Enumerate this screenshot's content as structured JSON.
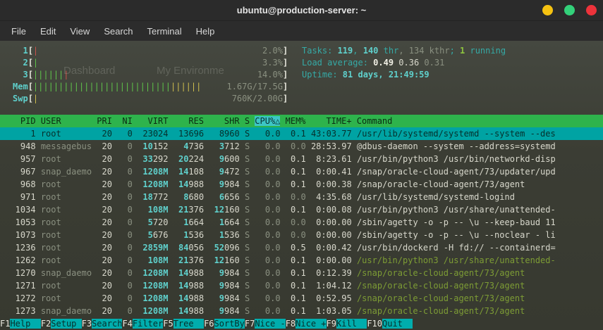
{
  "window": {
    "title": "ubuntu@production-server: ~"
  },
  "window_controls": [
    {
      "name": "minimize",
      "color": "#f5c211"
    },
    {
      "name": "maximize",
      "color": "#33d17a"
    },
    {
      "name": "close",
      "color": "#ed333b"
    }
  ],
  "menu": {
    "items": [
      "File",
      "Edit",
      "View",
      "Search",
      "Terminal",
      "Help"
    ]
  },
  "ghosts": [
    "Dashboard",
    "My Environme"
  ],
  "colors": {
    "cyan": "#35aaa6",
    "bcyan": "#5fd0cc",
    "white": "#d8d8cc",
    "bwhite": "#f0efe4",
    "gray": "#8a9080",
    "green": "#8ec43f",
    "cmdgreen": "#7d9c35",
    "headergreen": "#2eb34c",
    "selcyan": "#00a3a3",
    "fncyan": "#00adad"
  },
  "htop": {
    "meters": [
      {
        "label": "1",
        "ticks": [
          [
            "red",
            1
          ]
        ],
        "value": "2.0%"
      },
      {
        "label": "2",
        "ticks": [
          [
            "green",
            1
          ]
        ],
        "value": "3.3%"
      },
      {
        "label": "3",
        "ticks": [
          [
            "green",
            6
          ],
          [
            "red",
            1
          ]
        ],
        "value": "14.0%"
      },
      {
        "label": "Mem",
        "ticks": [
          [
            "green",
            27
          ],
          [
            "yellow",
            6
          ]
        ],
        "value": "1.67G/17.5G"
      },
      {
        "label": "Swp",
        "ticks": [
          [
            "yellow",
            1
          ]
        ],
        "value": "760K/2.00G"
      }
    ],
    "summary": [
      [
        [
          "Tasks: ",
          "cyan"
        ],
        [
          "119",
          "bcyan"
        ],
        [
          ", ",
          "cyan"
        ],
        [
          "140",
          "bcyan"
        ],
        [
          " thr",
          "cyan"
        ],
        [
          ", 134 kthr",
          "gray"
        ],
        [
          "; ",
          "cyan"
        ],
        [
          "1",
          "green"
        ],
        [
          " running",
          "cyan"
        ]
      ],
      [
        [
          "Load average: ",
          "cyan"
        ],
        [
          "0.49 ",
          "bwhite"
        ],
        [
          "0.36 ",
          "white"
        ],
        [
          "0.31",
          "gray"
        ]
      ],
      [
        [
          "Uptime: ",
          "cyan"
        ],
        [
          "81 days, 21:49:59",
          "bcyan"
        ]
      ]
    ],
    "columns": [
      "PID",
      "USER",
      "PRI",
      "NI",
      "VIRT",
      "RES",
      "SHR",
      "S",
      "CPU%△",
      "MEM%",
      "TIME+",
      "Command"
    ],
    "sort_column": "CPU%△",
    "rows": [
      {
        "pid": "1",
        "user": "root",
        "pri": "20",
        "ni": "0",
        "virt": "23024",
        "res": "13696",
        "shr": "8960",
        "s": "S",
        "cpu": "0.0",
        "mem": "0.1",
        "time": "43:03.77",
        "cmd": "/usr/lib/systemd/systemd --system --des",
        "selected": true
      },
      {
        "pid": "948",
        "user": "messagebus",
        "pri": "20",
        "ni": "0",
        "virt": "10152",
        "res": "4736",
        "shr": "3712",
        "s": "S",
        "cpu": "0.0",
        "mem": "0.0",
        "time": "28:53.97",
        "cmd": "@dbus-daemon --system --address=systemd"
      },
      {
        "pid": "957",
        "user": "root",
        "pri": "20",
        "ni": "0",
        "virt": "33292",
        "res": "20224",
        "shr": "9600",
        "s": "S",
        "cpu": "0.0",
        "mem": "0.1",
        "time": "8:23.61",
        "cmd": "/usr/bin/python3 /usr/bin/networkd-disp"
      },
      {
        "pid": "967",
        "user": "snap_daemo",
        "pri": "20",
        "ni": "0",
        "virt": "1208M",
        "res": "14108",
        "shr": "9472",
        "s": "S",
        "cpu": "0.0",
        "mem": "0.1",
        "time": "0:00.41",
        "cmd": "/snap/oracle-cloud-agent/73/updater/upd"
      },
      {
        "pid": "968",
        "user": "root",
        "pri": "20",
        "ni": "0",
        "virt": "1208M",
        "res": "14988",
        "shr": "9984",
        "s": "S",
        "cpu": "0.0",
        "mem": "0.1",
        "time": "0:00.38",
        "cmd": "/snap/oracle-cloud-agent/73/agent"
      },
      {
        "pid": "971",
        "user": "root",
        "pri": "20",
        "ni": "0",
        "virt": "18772",
        "res": "8680",
        "shr": "6656",
        "s": "S",
        "cpu": "0.0",
        "mem": "0.0",
        "time": "4:35.68",
        "cmd": "/usr/lib/systemd/systemd-logind"
      },
      {
        "pid": "1034",
        "user": "root",
        "pri": "20",
        "ni": "0",
        "virt": "108M",
        "res": "21376",
        "shr": "12160",
        "s": "S",
        "cpu": "0.0",
        "mem": "0.1",
        "time": "0:00.08",
        "cmd": "/usr/bin/python3 /usr/share/unattended-"
      },
      {
        "pid": "1053",
        "user": "root",
        "pri": "20",
        "ni": "0",
        "virt": "5720",
        "res": "1664",
        "shr": "1664",
        "s": "S",
        "cpu": "0.0",
        "mem": "0.0",
        "time": "0:00.00",
        "cmd": "/sbin/agetty -o -p -- \\u --keep-baud 11"
      },
      {
        "pid": "1073",
        "user": "root",
        "pri": "20",
        "ni": "0",
        "virt": "5676",
        "res": "1536",
        "shr": "1536",
        "s": "S",
        "cpu": "0.0",
        "mem": "0.0",
        "time": "0:00.00",
        "cmd": "/sbin/agetty -o -p -- \\u --noclear - li"
      },
      {
        "pid": "1236",
        "user": "root",
        "pri": "20",
        "ni": "0",
        "virt": "2859M",
        "res": "84056",
        "shr": "52096",
        "s": "S",
        "cpu": "0.0",
        "mem": "0.5",
        "time": "0:00.42",
        "cmd": "/usr/bin/dockerd -H fd:// --containerd="
      },
      {
        "pid": "1262",
        "user": "root",
        "pri": "20",
        "ni": "0",
        "virt": "108M",
        "res": "21376",
        "shr": "12160",
        "s": "S",
        "cpu": "0.0",
        "mem": "0.1",
        "time": "0:00.00",
        "cmd": "/usr/bin/python3 /usr/share/unattended-",
        "green": true
      },
      {
        "pid": "1270",
        "user": "snap_daemo",
        "pri": "20",
        "ni": "0",
        "virt": "1208M",
        "res": "14988",
        "shr": "9984",
        "s": "S",
        "cpu": "0.0",
        "mem": "0.1",
        "time": "0:12.39",
        "cmd": "/snap/oracle-cloud-agent/73/agent",
        "green": true
      },
      {
        "pid": "1271",
        "user": "root",
        "pri": "20",
        "ni": "0",
        "virt": "1208M",
        "res": "14988",
        "shr": "9984",
        "s": "S",
        "cpu": "0.0",
        "mem": "0.1",
        "time": "1:04.12",
        "cmd": "/snap/oracle-cloud-agent/73/agent",
        "green": true
      },
      {
        "pid": "1272",
        "user": "root",
        "pri": "20",
        "ni": "0",
        "virt": "1208M",
        "res": "14988",
        "shr": "9984",
        "s": "S",
        "cpu": "0.0",
        "mem": "0.1",
        "time": "0:52.95",
        "cmd": "/snap/oracle-cloud-agent/73/agent",
        "green": true
      },
      {
        "pid": "1273",
        "user": "snap_daemo",
        "pri": "20",
        "ni": "0",
        "virt": "1208M",
        "res": "14988",
        "shr": "9984",
        "s": "S",
        "cpu": "0.0",
        "mem": "0.1",
        "time": "1:03.05",
        "cmd": "/snap/oracle-cloud-agent/73/agent",
        "green": true
      }
    ],
    "fkeys": [
      {
        "key": "F1",
        "label": "Help"
      },
      {
        "key": "F2",
        "label": "Setup"
      },
      {
        "key": "F3",
        "label": "Search"
      },
      {
        "key": "F4",
        "label": "Filter"
      },
      {
        "key": "F5",
        "label": "Tree"
      },
      {
        "key": "F6",
        "label": "SortBy"
      },
      {
        "key": "F7",
        "label": "Nice -"
      },
      {
        "key": "F8",
        "label": "Nice +"
      },
      {
        "key": "F9",
        "label": "Kill"
      },
      {
        "key": "F10",
        "label": "Quit"
      }
    ]
  }
}
